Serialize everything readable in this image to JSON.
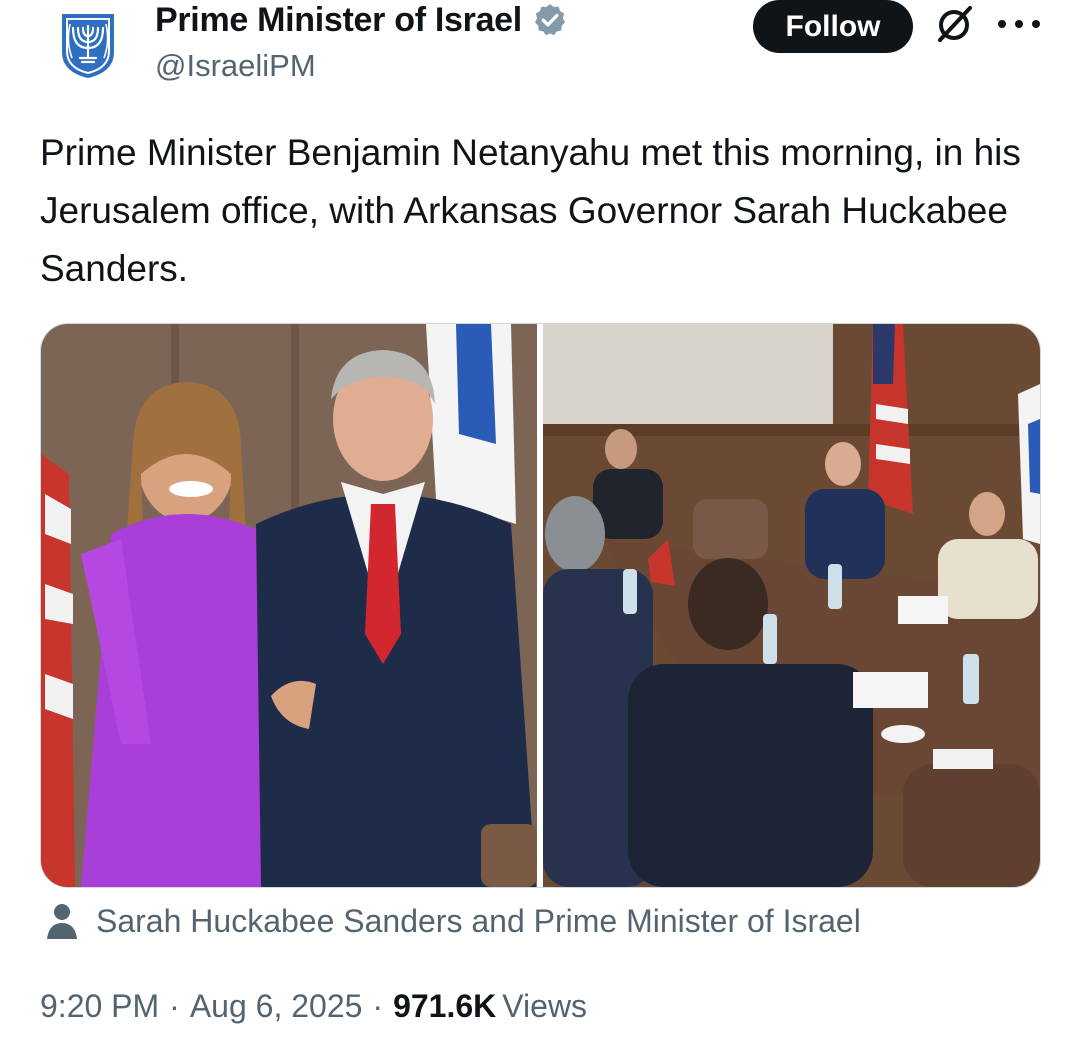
{
  "author": {
    "name": "Prime Minister of Israel",
    "handle": "@IsraeliPM",
    "verified": true,
    "avatar": "israel-emblem"
  },
  "actions": {
    "follow_label": "Follow",
    "grok_icon": "grok-icon",
    "more_icon": "more-icon"
  },
  "tweet": {
    "text": "Prime Minister Benjamin Netanyahu met this morning, in his Jerusalem office, with Arkansas Governor Sarah Huckabee Sanders.",
    "media": [
      {
        "kind": "photo",
        "subject": "handshake"
      },
      {
        "kind": "photo",
        "subject": "meeting-table"
      }
    ],
    "tagged_caption": "Sarah Huckabee Sanders and Prime Minister of Israel",
    "time": "9:20 PM",
    "separator": "·",
    "date": "Aug 6, 2025",
    "views_count": "971.6K",
    "views_label": "Views"
  },
  "colors": {
    "text": "#0f1419",
    "secondary": "#536471",
    "verified_badge": "#829aab",
    "follow_bg": "#0f1419"
  }
}
